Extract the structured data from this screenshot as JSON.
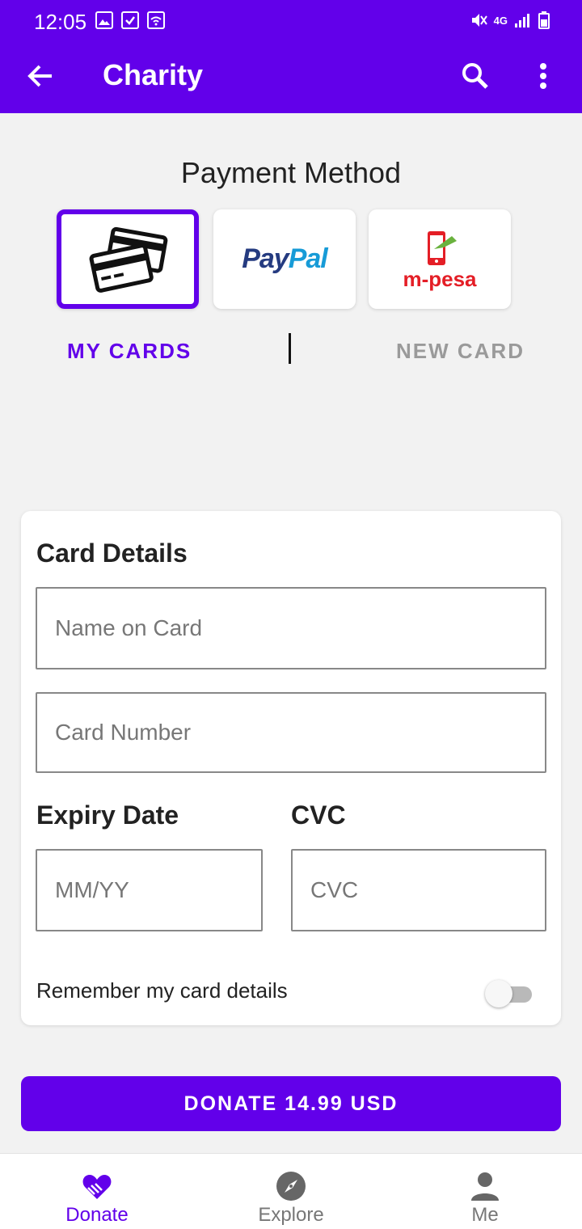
{
  "status_bar": {
    "time": "12:05",
    "network": "4G"
  },
  "app_bar": {
    "title": "Charity"
  },
  "payment": {
    "heading": "Payment Method",
    "methods": [
      {
        "name": "cards",
        "selected": true
      },
      {
        "name": "PayPal",
        "logo_text_1": "Pay",
        "logo_text_2": "Pal"
      },
      {
        "name": "m-pesa",
        "logo_text": "m-pesa"
      }
    ],
    "tab_my_cards": "MY CARDS",
    "tab_new_card": "NEW CARD"
  },
  "card_details": {
    "title": "Card Details",
    "name_placeholder": "Name on Card",
    "number_placeholder": "Card Number",
    "expiry_label": "Expiry Date",
    "expiry_placeholder": "MM/YY",
    "cvc_label": "CVC",
    "cvc_placeholder": "CVC",
    "remember_label": "Remember my card details",
    "remember_on": false
  },
  "donate_button": "DONATE 14.99 USD",
  "nav": [
    {
      "label": "Donate",
      "icon": "heart-hand-icon",
      "active": true
    },
    {
      "label": "Explore",
      "icon": "compass-icon",
      "active": false
    },
    {
      "label": "Me",
      "icon": "person-icon",
      "active": false
    }
  ],
  "colors": {
    "primary": "#6200ea",
    "inactive": "#9a9a9a",
    "paypal_dark": "#253b80",
    "paypal_light": "#179bd7",
    "mpesa_red": "#e41e26",
    "mpesa_green": "#6ab23e"
  }
}
